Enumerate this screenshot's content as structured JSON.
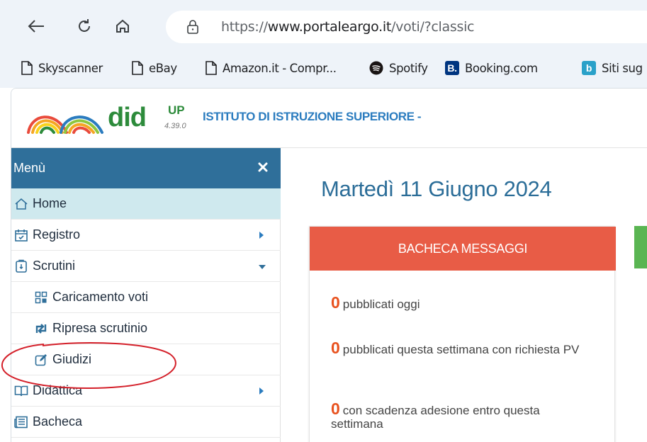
{
  "browser": {
    "url_scheme": "https://",
    "url_host": "www.portaleargo.it",
    "url_path": "/voti/?classic",
    "bookmarks": [
      {
        "label": "Skyscanner",
        "icon": "page-icon"
      },
      {
        "label": "eBay",
        "icon": "page-icon"
      },
      {
        "label": "Amazon.it - Compr...",
        "icon": "page-icon"
      },
      {
        "label": "Spotify",
        "icon": "spotify-icon"
      },
      {
        "label": "Booking.com",
        "icon": "booking-icon"
      },
      {
        "label": "Siti sug",
        "icon": "bing-icon"
      }
    ]
  },
  "app": {
    "logo": "did",
    "logo_sup": "UP",
    "version": "4.39.0",
    "school": "ISTITUTO DI ISTRUZIONE SUPERIORE -"
  },
  "sidebar": {
    "title": "Menù",
    "items": [
      {
        "label": "Home",
        "icon": "home-icon"
      },
      {
        "label": "Registro",
        "icon": "calendar-check-icon"
      },
      {
        "label": "Scrutini",
        "icon": "clipboard-icon"
      },
      {
        "label": "Caricamento voti",
        "icon": "grid-icon"
      },
      {
        "label": "Ripresa scrutinio",
        "icon": "retweet-icon"
      },
      {
        "label": "Giudizi",
        "icon": "edit-icon"
      },
      {
        "label": "Didattica",
        "icon": "book-icon"
      },
      {
        "label": "Bacheca",
        "icon": "newspaper-icon"
      }
    ]
  },
  "main": {
    "date": "Martedì 11 Giugno 2024",
    "card": {
      "title": "BACHECA MESSAGGI",
      "rows": [
        {
          "count": "0",
          "text": "pubblicati oggi"
        },
        {
          "count": "0",
          "text": "pubblicati questa settimana con richiesta PV"
        },
        {
          "count": "0",
          "text": "con scadenza adesione entro questa settimana"
        }
      ]
    }
  },
  "colors": {
    "menu_header": "#2f6f9a",
    "active_item": "#cfe9ee",
    "card_header": "#e85c46",
    "count": "#e8521f",
    "logo_green": "#2d8b3b",
    "annotation_red": "#d4202a"
  }
}
